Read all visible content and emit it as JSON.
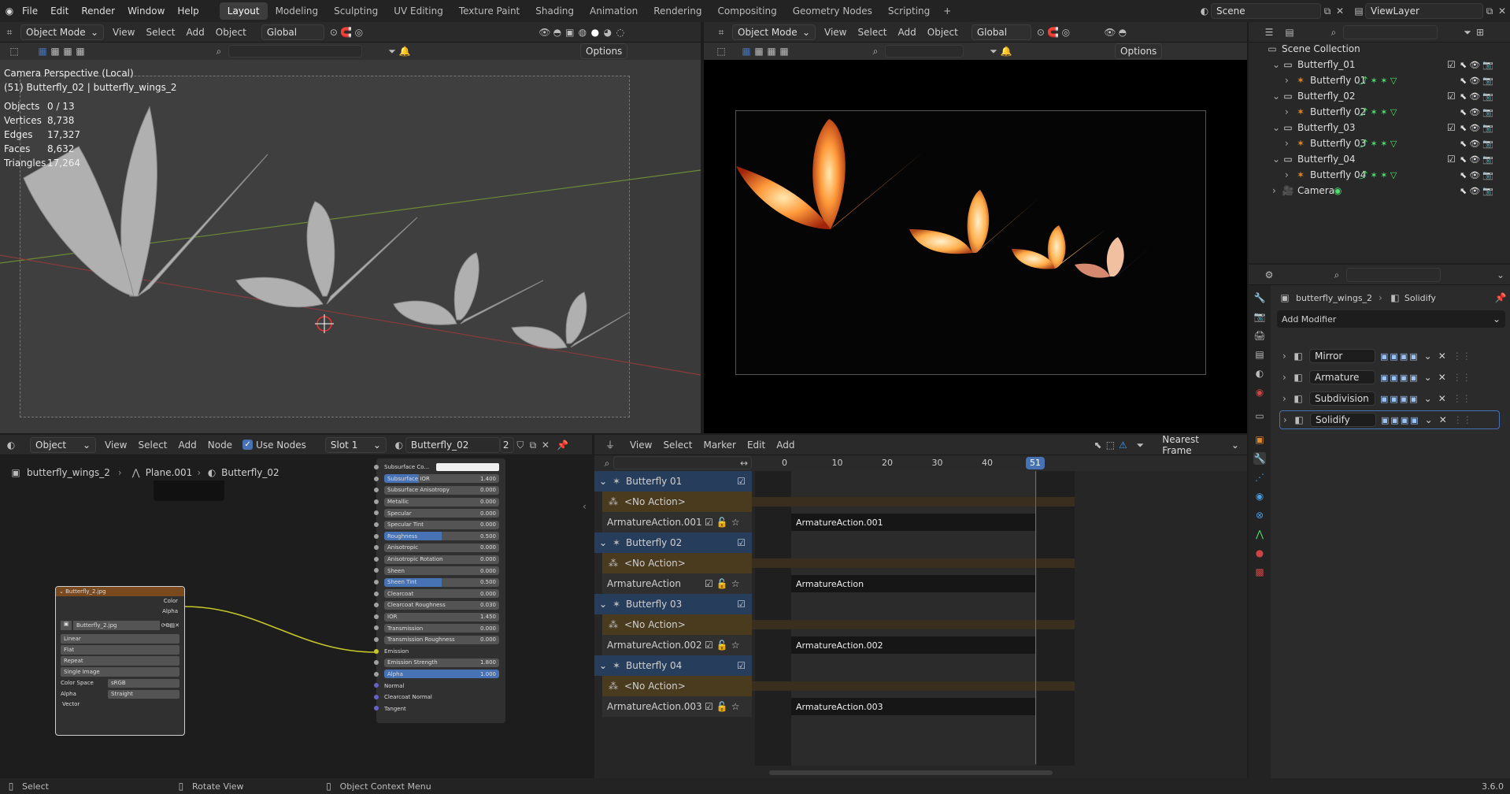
{
  "topbar": {
    "menus": [
      "File",
      "Edit",
      "Render",
      "Window",
      "Help"
    ],
    "workspaces": [
      "Layout",
      "Modeling",
      "Sculpting",
      "UV Editing",
      "Texture Paint",
      "Shading",
      "Animation",
      "Rendering",
      "Compositing",
      "Geometry Nodes",
      "Scripting"
    ],
    "active_workspace": "Layout",
    "add_workspace": "+",
    "scene": "Scene",
    "view_layer": "ViewLayer"
  },
  "viewport_left": {
    "mode": "Object Mode",
    "menus": [
      "View",
      "Select",
      "Add",
      "Object"
    ],
    "orientation": "Global",
    "options": "Options",
    "overlay_title": "Camera Perspective (Local)",
    "overlay_subtitle": "(51) Butterfly_02 | butterfly_wings_2",
    "stats": [
      {
        "label": "Objects",
        "value": "0 / 13"
      },
      {
        "label": "Vertices",
        "value": "8,738"
      },
      {
        "label": "Edges",
        "value": "17,327"
      },
      {
        "label": "Faces",
        "value": "8,632"
      },
      {
        "label": "Triangles",
        "value": "17,264"
      }
    ]
  },
  "viewport_right": {
    "mode": "Object Mode",
    "menus": [
      "View",
      "Select",
      "Add",
      "Object"
    ],
    "orientation": "Global",
    "options": "Options"
  },
  "outliner": {
    "root": "Scene Collection",
    "items": [
      {
        "name": "Butterfly_01",
        "type": "collection"
      },
      {
        "name": "Butterfly 01",
        "type": "armature"
      },
      {
        "name": "Butterfly_02",
        "type": "collection"
      },
      {
        "name": "Butterfly 02",
        "type": "armature"
      },
      {
        "name": "Butterfly_03",
        "type": "collection"
      },
      {
        "name": "Butterfly 03",
        "type": "armature"
      },
      {
        "name": "Butterfly_04",
        "type": "collection"
      },
      {
        "name": "Butterfly 04",
        "type": "armature"
      },
      {
        "name": "Camera",
        "type": "camera"
      }
    ]
  },
  "properties": {
    "object": "butterfly_wings_2",
    "modifier_crumb": "Solidify",
    "add_modifier": "Add Modifier",
    "modifiers": [
      "Mirror",
      "Armature",
      "Subdivision",
      "Solidify"
    ]
  },
  "node_editor": {
    "editor_type": "Object",
    "menus": [
      "View",
      "Select",
      "Add",
      "Node"
    ],
    "use_nodes": "Use Nodes",
    "slot": "Slot 1",
    "material": "Butterfly_02",
    "users": "2",
    "breadcrumb": [
      "butterfly_wings_2",
      "Plane.001",
      "Butterfly_02"
    ],
    "image_node": {
      "title": "Butterfly_2.jpg",
      "outputs": [
        "Color",
        "Alpha"
      ],
      "image": "Butterfly_2.jpg",
      "interpolation": "Linear",
      "projection": "Flat",
      "extension": "Repeat",
      "source": "Single Image",
      "color_space_label": "Color Space",
      "color_space": "sRGB",
      "alpha_label": "Alpha",
      "alpha": "Straight",
      "vector": "Vector"
    },
    "bsdf_rows": [
      {
        "label": "Subsurface Co...",
        "value": "",
        "kind": "color"
      },
      {
        "label": "Subsurface IOR",
        "value": "1.400",
        "fill": 0.3
      },
      {
        "label": "Subsurface Anisotropy",
        "value": "0.000"
      },
      {
        "label": "Metallic",
        "value": "0.000"
      },
      {
        "label": "Specular",
        "value": "0.000"
      },
      {
        "label": "Specular Tint",
        "value": "0.000"
      },
      {
        "label": "Roughness",
        "value": "0.500",
        "fill": 0.5
      },
      {
        "label": "Anisotropic",
        "value": "0.000"
      },
      {
        "label": "Anisotropic Rotation",
        "value": "0.000"
      },
      {
        "label": "Sheen",
        "value": "0.000"
      },
      {
        "label": "Sheen Tint",
        "value": "0.500",
        "fill": 0.5
      },
      {
        "label": "Clearcoat",
        "value": "0.000"
      },
      {
        "label": "Clearcoat Roughness",
        "value": "0.030"
      },
      {
        "label": "IOR",
        "value": "1.450"
      },
      {
        "label": "Transmission",
        "value": "0.000"
      },
      {
        "label": "Transmission Roughness",
        "value": "0.000"
      },
      {
        "label": "Emission",
        "value": "",
        "kind": "socket"
      },
      {
        "label": "Emission Strength",
        "value": "1.800"
      },
      {
        "label": "Alpha",
        "value": "1.000",
        "fill": 1.0
      },
      {
        "label": "Normal",
        "value": "",
        "kind": "socket"
      },
      {
        "label": "Clearcoat Normal",
        "value": "",
        "kind": "socket"
      },
      {
        "label": "Tangent",
        "value": "",
        "kind": "socket"
      }
    ]
  },
  "nla": {
    "menus": [
      "View",
      "Select",
      "Marker",
      "Edit",
      "Add"
    ],
    "snap": "Nearest Frame",
    "ruler": [
      "0",
      "10",
      "20",
      "30",
      "40"
    ],
    "current_frame": "51",
    "tracks": [
      {
        "name": "Butterfly 01",
        "no_action": "<No Action>",
        "action": "ArmatureAction.001"
      },
      {
        "name": "Butterfly 02",
        "no_action": "<No Action>",
        "action": "ArmatureAction"
      },
      {
        "name": "Butterfly 03",
        "no_action": "<No Action>",
        "action": "ArmatureAction.002"
      },
      {
        "name": "Butterfly 04",
        "no_action": "<No Action>",
        "action": "ArmatureAction.003"
      }
    ]
  },
  "statusbar": {
    "items": [
      "Select",
      "Rotate View",
      "Object Context Menu"
    ],
    "version": "3.6.0"
  },
  "colors": {
    "accent": "#4772b3",
    "track_blue": "#263d5c",
    "action_orange": "#4a3a1e",
    "header": "#2a2a2a",
    "background": "#1d1d1d"
  }
}
